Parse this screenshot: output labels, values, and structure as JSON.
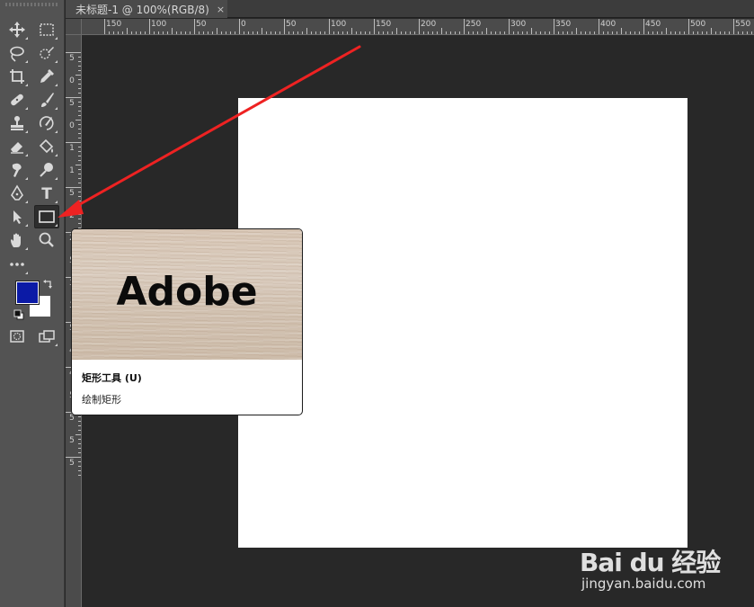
{
  "document_tab": {
    "title": "未标题-1 @ 100%(RGB/8)",
    "close": "×"
  },
  "ruler_top": {
    "labels": [
      "150",
      "100",
      "50",
      "0",
      "50",
      "100",
      "150",
      "200",
      "250",
      "300",
      "350",
      "400",
      "450",
      "500",
      "550"
    ]
  },
  "ruler_left": {
    "labels": [
      "5",
      "0",
      "5",
      "0",
      "1",
      "1",
      "5",
      "2",
      "2",
      "5",
      "3",
      "3",
      "5",
      "4",
      "4",
      "5",
      "5",
      "5",
      "5"
    ]
  },
  "toolbar": {
    "tools": [
      {
        "name": "move-icon"
      },
      {
        "name": "marquee-icon"
      },
      {
        "name": "lasso-icon"
      },
      {
        "name": "quick-select-icon"
      },
      {
        "name": "crop-icon"
      },
      {
        "name": "eyedropper-icon"
      },
      {
        "name": "healing-brush-icon"
      },
      {
        "name": "brush-icon"
      },
      {
        "name": "stamp-icon"
      },
      {
        "name": "history-brush-icon"
      },
      {
        "name": "eraser-icon"
      },
      {
        "name": "paint-bucket-icon"
      },
      {
        "name": "smudge-icon"
      },
      {
        "name": "dodge-icon"
      },
      {
        "name": "pen-icon"
      },
      {
        "name": "type-icon"
      },
      {
        "name": "path-select-icon"
      },
      {
        "name": "rectangle-icon"
      },
      {
        "name": "hand-icon"
      },
      {
        "name": "zoom-icon"
      },
      {
        "name": "more-tools-icon"
      }
    ],
    "foreground_color": "#0b1aa6",
    "background_color": "#ffffff",
    "type_label": "T"
  },
  "tooltip": {
    "image_text": "Adobe",
    "title": "矩形工具 (U)",
    "description": "绘制矩形"
  },
  "annotation": {
    "color": "#ee2222"
  },
  "watermark": {
    "brand": "Bai du 经验",
    "url": "jingyan.baidu.com"
  }
}
